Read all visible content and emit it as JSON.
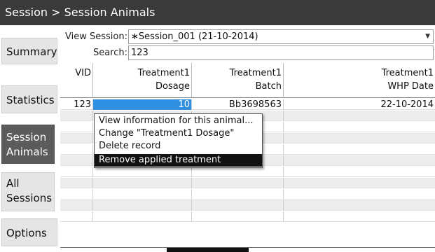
{
  "breadcrumb": "Session > Session Animals",
  "sidebar": {
    "items": [
      {
        "label": "Summary",
        "active": false
      },
      {
        "label": "Statistics",
        "active": false
      },
      {
        "label": "Session Animals",
        "active": true
      },
      {
        "label": "All Sessions",
        "active": false
      },
      {
        "label": "Options",
        "active": false
      }
    ]
  },
  "filters": {
    "view_session_label": "View Session:",
    "view_session_value": "∗Session_001 (21-10-2014)",
    "search_label": "Search:",
    "search_value": "123"
  },
  "table": {
    "columns": [
      {
        "line1": "VID",
        "line2": ""
      },
      {
        "line1": "Treatment1",
        "line2": "Dosage"
      },
      {
        "line1": "Treatment1",
        "line2": "Batch"
      },
      {
        "line1": "Treatment1",
        "line2": "WHP Date"
      }
    ],
    "rows": [
      [
        "123",
        "10",
        "Bb3698563",
        "22-10-2014"
      ]
    ]
  },
  "context_menu": {
    "items": [
      "View information for this animal...",
      "Change \"Treatment1 Dosage\"",
      "Delete record",
      "Remove applied treatment"
    ],
    "highlighted_index": 3
  },
  "colors": {
    "titlebar": "#3a3a3a",
    "selection": "#2f8fe0",
    "active_nav": "#5b5b5b"
  }
}
